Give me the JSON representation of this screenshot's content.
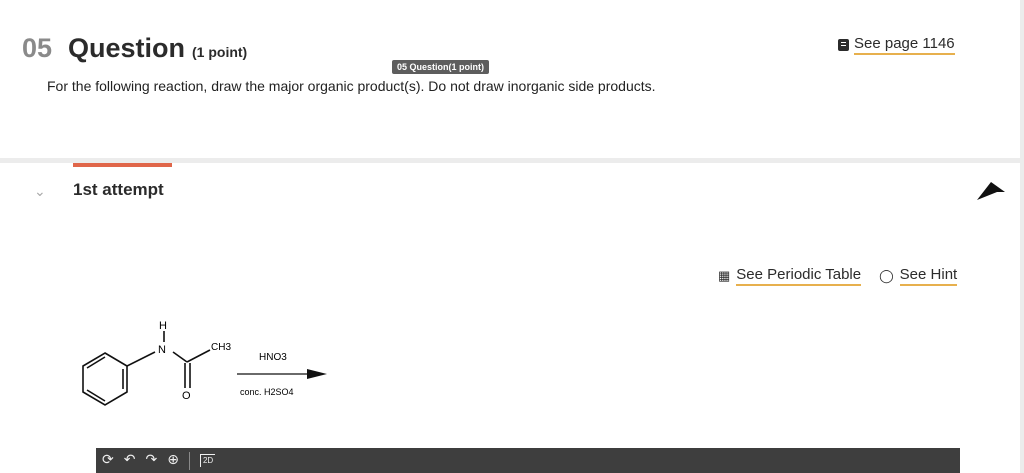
{
  "question": {
    "number": "05",
    "title": "Question",
    "points": "(1 point)",
    "tag": "05 Question(1 point)",
    "text": "For the following reaction, draw the major organic product(s). Do not draw inorganic side products.",
    "see_page": "See page 1146"
  },
  "attempt": {
    "label": "1st attempt",
    "see_periodic_table": "See Periodic Table",
    "see_hint": "See Hint"
  },
  "reaction": {
    "reagent_top": "HNO3",
    "reagent_bottom": "conc. H2SO4",
    "atoms": {
      "h": "H",
      "n": "N",
      "o": "O",
      "ch3": "CH3"
    }
  },
  "toolbar": {
    "two_d": "2D"
  },
  "colors": {
    "accent_tab": "#e0664a",
    "link_underline": "#e7b04d",
    "toolbar_bg": "#3e3e3e"
  },
  "icons": [
    "book-icon",
    "chevron-down-icon",
    "flag-icon",
    "periodic-table-icon",
    "lightbulb-icon",
    "clear-icon",
    "undo-icon",
    "redo-icon",
    "zoom-icon"
  ]
}
